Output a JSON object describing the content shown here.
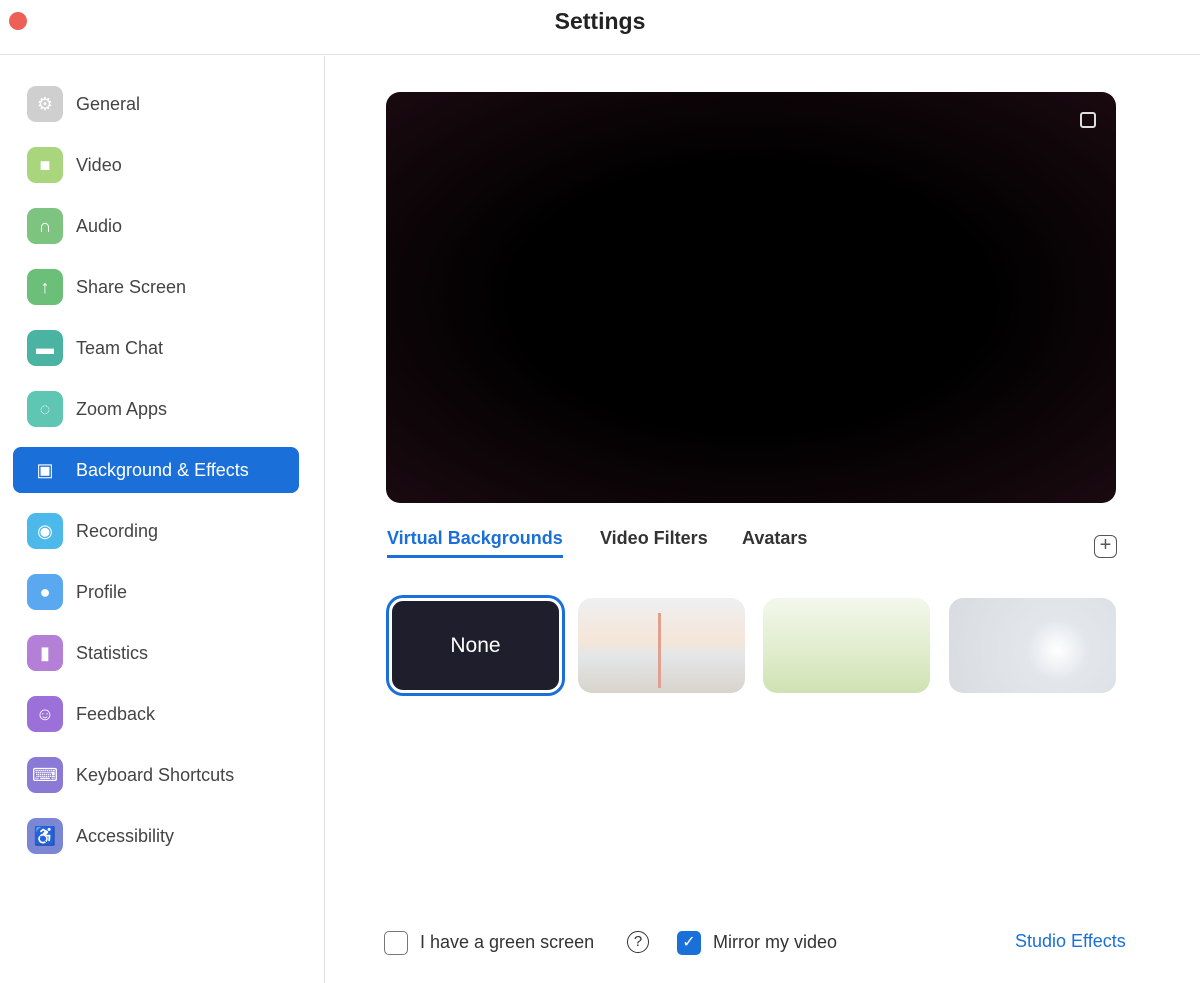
{
  "window": {
    "title": "Settings"
  },
  "sidebar": {
    "items": [
      {
        "label": "General",
        "icon": "gear-icon",
        "color": "#cfcfcf"
      },
      {
        "label": "Video",
        "icon": "video-camera-icon",
        "color": "#a9d67c"
      },
      {
        "label": "Audio",
        "icon": "headphones-icon",
        "color": "#7cc47f"
      },
      {
        "label": "Share Screen",
        "icon": "share-screen-icon",
        "color": "#6bbf78"
      },
      {
        "label": "Team Chat",
        "icon": "chat-bubble-icon",
        "color": "#4bb3a1"
      },
      {
        "label": "Zoom Apps",
        "icon": "apps-icon",
        "color": "#5ec6b2"
      },
      {
        "label": "Background & Effects",
        "icon": "person-card-icon",
        "color": "#1a6fd8",
        "active": true
      },
      {
        "label": "Recording",
        "icon": "record-icon",
        "color": "#4db8ea"
      },
      {
        "label": "Profile",
        "icon": "profile-icon",
        "color": "#5aa9f0"
      },
      {
        "label": "Statistics",
        "icon": "bar-chart-icon",
        "color": "#b47fd6"
      },
      {
        "label": "Feedback",
        "icon": "smiley-icon",
        "color": "#9b70d8"
      },
      {
        "label": "Keyboard Shortcuts",
        "icon": "keyboard-icon",
        "color": "#8a7ad6"
      },
      {
        "label": "Accessibility",
        "icon": "accessibility-icon",
        "color": "#7b87d4"
      }
    ]
  },
  "main": {
    "tabs": [
      {
        "label": "Virtual Backgrounds",
        "active": true
      },
      {
        "label": "Video Filters"
      },
      {
        "label": "Avatars"
      }
    ],
    "backgrounds": [
      {
        "label": "None",
        "selected": true
      },
      {
        "name": "golden-gate-bridge"
      },
      {
        "name": "grass"
      },
      {
        "name": "earth-from-space"
      }
    ],
    "green_screen": {
      "label": "I have a green screen",
      "checked": false
    },
    "mirror": {
      "label": "Mirror my video",
      "checked": true
    },
    "studio_effects": "Studio Effects",
    "accent": "#1a6fd8"
  }
}
